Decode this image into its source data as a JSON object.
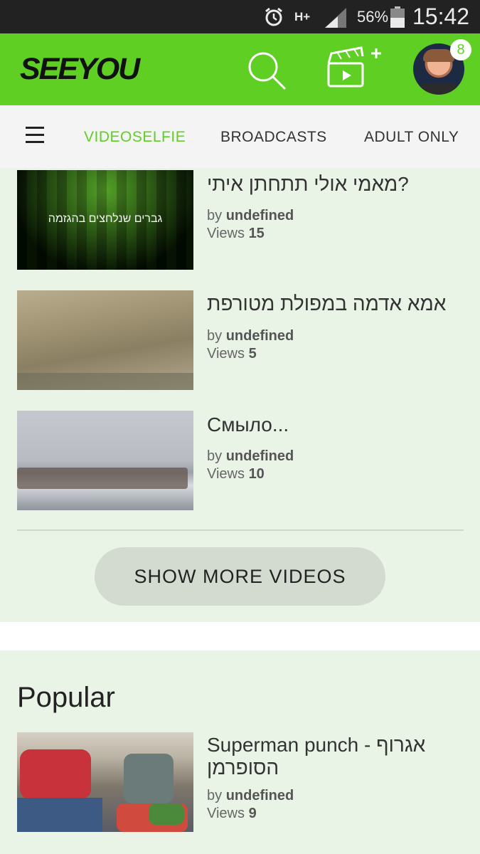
{
  "status_bar": {
    "network": "H+",
    "battery": "56%",
    "time": "15:42"
  },
  "header": {
    "logo": "SEEYOU",
    "notification_count": "8"
  },
  "tabs": [
    {
      "label": "VIDEOSELFIE",
      "active": true
    },
    {
      "label": "BROADCASTS",
      "active": false
    },
    {
      "label": "ADULT ONLY",
      "active": false
    }
  ],
  "videos": [
    {
      "title": "מאמי אולי תתחתן איתי?",
      "thumb_text": "גברים שנלחצים בהגזמה",
      "by_label": "by",
      "author": "undefined",
      "views_label": "Views",
      "views": "15"
    },
    {
      "title": "אמא אדמה במפולת מטורפת",
      "by_label": "by",
      "author": "undefined",
      "views_label": "Views",
      "views": "5"
    },
    {
      "title": "Смыло...",
      "by_label": "by",
      "author": "undefined",
      "views_label": "Views",
      "views": "10"
    }
  ],
  "show_more_label": "SHOW MORE VIDEOS",
  "popular": {
    "title": "Popular",
    "items": [
      {
        "title": "Superman punch - אגרוף הסופרמן",
        "by_label": "by",
        "author": "undefined",
        "views_label": "Views",
        "views": "9"
      }
    ]
  },
  "colors": {
    "brand_green": "#5fcf24",
    "list_bg": "#e9f3e6"
  }
}
